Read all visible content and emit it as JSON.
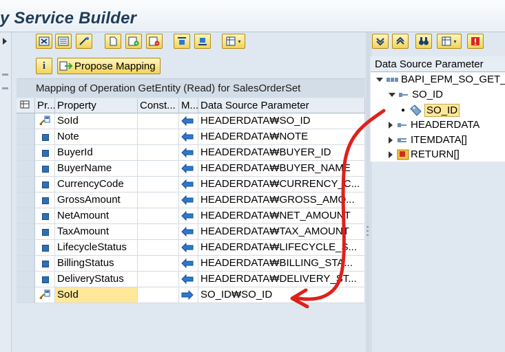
{
  "window": {
    "title": "y Service Builder"
  },
  "toolbar": {
    "propose_label": "Propose Mapping",
    "info_label": "i"
  },
  "section": {
    "title": "Mapping of Operation GetEntity (Read) for SalesOrderSet"
  },
  "grid": {
    "columns": [
      "Pr...",
      "Property",
      "Const...",
      "M...",
      "Data Source Parameter"
    ],
    "rows": [
      {
        "icon": "key-icon",
        "property": "SoId",
        "constant": "",
        "direction": "left",
        "source": "HEADERDATA₩SO_ID"
      },
      {
        "icon": "field-icon",
        "property": "Note",
        "constant": "",
        "direction": "left",
        "source": "HEADERDATA₩NOTE"
      },
      {
        "icon": "field-icon",
        "property": "BuyerId",
        "constant": "",
        "direction": "left",
        "source": "HEADERDATA₩BUYER_ID"
      },
      {
        "icon": "field-icon",
        "property": "BuyerName",
        "constant": "",
        "direction": "left",
        "source": "HEADERDATA₩BUYER_NAME"
      },
      {
        "icon": "field-icon",
        "property": "CurrencyCode",
        "constant": "",
        "direction": "left",
        "source": "HEADERDATA₩CURRENCY_C..."
      },
      {
        "icon": "field-icon",
        "property": "GrossAmount",
        "constant": "",
        "direction": "left",
        "source": "HEADERDATA₩GROSS_AMO..."
      },
      {
        "icon": "field-icon",
        "property": "NetAmount",
        "constant": "",
        "direction": "left",
        "source": "HEADERDATA₩NET_AMOUNT"
      },
      {
        "icon": "field-icon",
        "property": "TaxAmount",
        "constant": "",
        "direction": "left",
        "source": "HEADERDATA₩TAX_AMOUNT"
      },
      {
        "icon": "field-icon",
        "property": "LifecycleStatus",
        "constant": "",
        "direction": "left",
        "source": "HEADERDATA₩LIFECYCLE_S..."
      },
      {
        "icon": "field-icon",
        "property": "BillingStatus",
        "constant": "",
        "direction": "left",
        "source": "HEADERDATA₩BILLING_STA..."
      },
      {
        "icon": "field-icon",
        "property": "DeliveryStatus",
        "constant": "",
        "direction": "left",
        "source": "HEADERDATA₩DELIVERY_ST..."
      },
      {
        "icon": "key-icon",
        "property": "SoId",
        "constant": "",
        "direction": "right",
        "source": "SO_ID₩SO_ID"
      }
    ]
  },
  "tree": {
    "header": "Data Source Parameter",
    "nodes": [
      {
        "label": "BAPI_EPM_SO_GET_",
        "icon": "function-icon"
      },
      {
        "label": "SO_ID",
        "icon": "structure-icon"
      },
      {
        "label": "SO_ID",
        "icon": "element-icon"
      },
      {
        "label": "HEADERDATA",
        "icon": "structure-icon"
      },
      {
        "label": "ITEMDATA[]",
        "icon": "table-icon"
      },
      {
        "label": "RETURN[]",
        "icon": "return-icon"
      }
    ]
  },
  "colors": {
    "highlight": "#ffe79a",
    "arrow_annotation": "#e0201b",
    "grid_arrow": "#2b78d3"
  }
}
